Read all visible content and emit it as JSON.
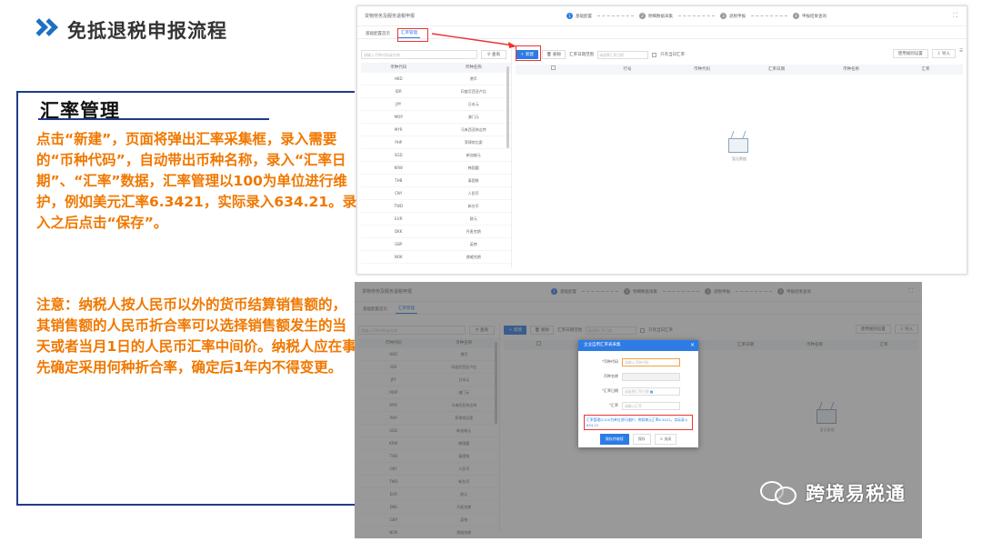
{
  "slide": {
    "title": "免抵退税申报流程",
    "panel_heading": "汇率管理",
    "body_text": "点击“新建”，页面将弹出汇率采集框，录入需要的“币种代码”，自动带出币种名称，录入“汇率日期”、“汇率”数据，汇率管理以100为单位进行维护，例如美元汇率6.3421，实际录入634.21。录入之后点击“保存”。",
    "note_text": "注意：纳税人按人民币以外的货币结算销售额的，其销售额的人民币折合率可以选择销售额发生的当天或者当月1日的人民币汇率中间价。纳税人应在事先确定采用何种折合率，确定后1年内不得变更。"
  },
  "app": {
    "brand": "货物劳务及服务退税申报",
    "steps": [
      {
        "num": "1",
        "label": "基础配置"
      },
      {
        "num": "2",
        "label": "明细数据采集"
      },
      {
        "num": "3",
        "label": "退税申报"
      },
      {
        "num": "4",
        "label": "申报结果查询"
      }
    ],
    "tabs": [
      "基础配置首页",
      "汇率管理"
    ],
    "search_placeholder": "请输入币种代码或名称",
    "search_btn": "查询",
    "list_headers": [
      "币种代码",
      "币种名称"
    ],
    "currencies": [
      {
        "code": "HKD",
        "name": "港币"
      },
      {
        "code": "IDR",
        "name": "印度尼西亚卢比"
      },
      {
        "code": "JPY",
        "name": "日本元"
      },
      {
        "code": "MOP",
        "name": "澳门元"
      },
      {
        "code": "MYR",
        "name": "马来西亚林吉特"
      },
      {
        "code": "PHP",
        "name": "菲律宾比索"
      },
      {
        "code": "SGD",
        "name": "新加坡元"
      },
      {
        "code": "KRW",
        "name": "韩国圆"
      },
      {
        "code": "THB",
        "name": "泰国铢"
      },
      {
        "code": "CNY",
        "name": "人民币"
      },
      {
        "code": "TWD",
        "name": "新台币"
      },
      {
        "code": "EUR",
        "name": "欧元"
      },
      {
        "code": "DKK",
        "name": "丹麦克朗"
      },
      {
        "code": "GBP",
        "name": "英镑"
      },
      {
        "code": "NOK",
        "name": "挪威克朗"
      }
    ],
    "toolbar": {
      "new": "新建",
      "delete": "删除",
      "date_label": "汇率日期范围",
      "date_placeholder": "请选择汇率日期",
      "checkbox_label": "只有当日汇率",
      "settings_btn": "使用规则设置",
      "import_btn": "导入"
    },
    "table_headers": [
      "行号",
      "币种代码",
      "币种名称",
      "汇率日期",
      "币种名称",
      "汇率"
    ],
    "empty_text": "暂无数据",
    "dialog": {
      "title": "企业自用汇率表采集",
      "fields": [
        {
          "label": "币种代码",
          "placeholder": "请输入币种代码",
          "required": true
        },
        {
          "label": "币种名称",
          "placeholder": "",
          "required": false
        },
        {
          "label": "汇率日期",
          "placeholder": "请选择汇率日期",
          "required": true
        },
        {
          "label": "汇率",
          "placeholder": "请输入汇率",
          "required": true
        }
      ],
      "hint": "汇率管理以100为单位进行维护，例如美元汇率6.3421，实际录入634.21",
      "btn_save_continue": "保存并继续",
      "btn_save": "保存",
      "btn_close": "关闭"
    }
  },
  "watermark": "跨境易税通"
}
